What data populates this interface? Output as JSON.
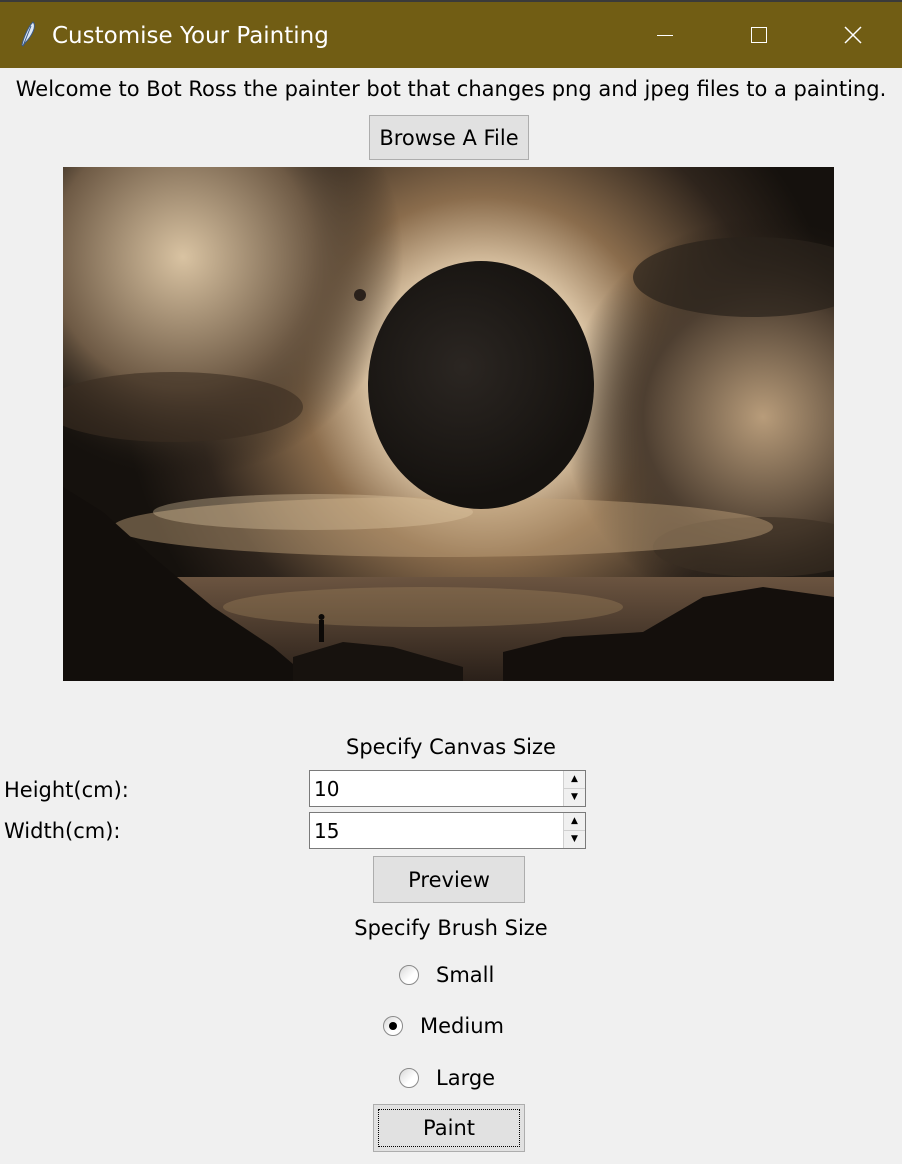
{
  "window": {
    "title": "Customise Your Painting",
    "titlebar_color": "#715d14",
    "app_icon": "feather-icon",
    "controls": [
      "minimize-icon",
      "maximize-icon",
      "close-icon"
    ],
    "close_glyph": "✕"
  },
  "welcome_text": "Welcome to Bot Ross the painter bot that changes png and jpeg files to a painting.",
  "browse_button": "Browse A File",
  "preview_image": {
    "description_icon": "eclipse-photo"
  },
  "canvas": {
    "heading": "Specify Canvas Size",
    "height_label": "Height(cm):",
    "height_value": "10",
    "width_label": "Width(cm):",
    "width_value": "15",
    "spin_up": "▲",
    "spin_down": "▼"
  },
  "preview_button": "Preview",
  "brush": {
    "heading": "Specify Brush Size",
    "options": [
      {
        "label": "Small",
        "selected": false
      },
      {
        "label": "Medium",
        "selected": true
      },
      {
        "label": "Large",
        "selected": false
      }
    ]
  },
  "paint_button": "Paint"
}
